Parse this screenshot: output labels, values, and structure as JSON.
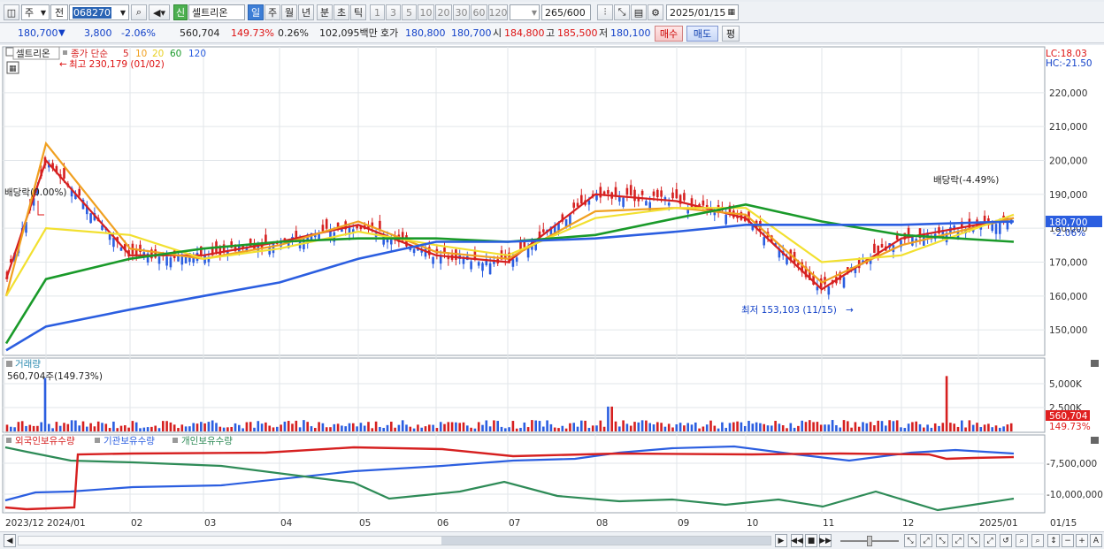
{
  "toolbar": {
    "period_type": "주",
    "market": "전",
    "code": "068270",
    "stock_name": "셀트리온",
    "new_badge": "신",
    "intervals": [
      "일",
      "주",
      "월",
      "년",
      "분",
      "초",
      "틱"
    ],
    "minute_options": [
      "1",
      "3",
      "5",
      "10",
      "20",
      "30",
      "60",
      "120"
    ],
    "count": "265",
    "count_max": "/600",
    "date": "2025/01/15"
  },
  "quote": {
    "price": "180,700",
    "arrow": "▼",
    "change": "3,800",
    "change_pct": "-2.06%",
    "volume": "560,704",
    "volume_ratio": "149.73%",
    "turnover_pct": "0.26%",
    "amount": "102,095백만",
    "ask_label": "호가",
    "bid_price": "180,800",
    "ask_price": "180,700",
    "open_label": "시",
    "open": "184,800",
    "high_label": "고",
    "high": "185,500",
    "low_label": "저",
    "low": "180,100",
    "buy_button": "매수",
    "sell_button": "매도",
    "eval_button": "평"
  },
  "price_panel": {
    "legend_name": "셀트리온",
    "legend_ma_label": "종가 단순",
    "ma_periods": [
      "5",
      "10",
      "20",
      "60",
      "120"
    ],
    "ma_colors": [
      "#d62020",
      "#f0a020",
      "#f2e030",
      "#1a9a2a",
      "#2b5ee0"
    ],
    "high_note": "최고 230,179 (01/02)",
    "low_note": "최저 153,103 (11/15)",
    "dividend_note_1": "배당락(0.00%)",
    "dividend_note_2": "배당락(-4.49%)",
    "lc": "LC:18.03",
    "hc": "HC:-21.50",
    "current_price_tag": "180,700",
    "current_pct_tag": "-2.06%",
    "y_ticks": [
      "220,000",
      "210,000",
      "200,000",
      "190,000",
      "180,000",
      "170,000",
      "160,000",
      "150,000"
    ]
  },
  "volume_panel": {
    "title": "거래량",
    "value": "560,704주(149.73%)",
    "y_ticks": [
      "5,000K",
      "2,500K"
    ],
    "tag_value": "560,704",
    "tag_pct": "149.73%"
  },
  "holdings_panel": {
    "series": [
      "외국인보유수량",
      "기관보유수량",
      "개인보유수량"
    ],
    "colors": [
      "#d62020",
      "#2b5ee0",
      "#2e8b57"
    ],
    "y_ticks": [
      "-7,500,000",
      "-10,000,000"
    ]
  },
  "x_axis": [
    "2023/12",
    "2024/01",
    "02",
    "03",
    "04",
    "05",
    "06",
    "07",
    "08",
    "09",
    "10",
    "11",
    "12",
    "2025/01",
    "01/15"
  ],
  "chart_data": {
    "type": "line",
    "title": "셀트리온",
    "x": [
      "2023/12",
      "2024/01",
      "02",
      "03",
      "04",
      "05",
      "06",
      "07",
      "08",
      "09",
      "10",
      "11",
      "12",
      "2025/01"
    ],
    "ylim": [
      143000,
      233000
    ],
    "series": [
      {
        "name": "5",
        "values": [
          165000,
          200000,
          172000,
          172000,
          176000,
          181000,
          172000,
          170000,
          190000,
          188000,
          183000,
          162000,
          177000,
          183000
        ]
      },
      {
        "name": "10",
        "values": [
          160000,
          205000,
          174000,
          171000,
          175000,
          182000,
          173000,
          171000,
          185000,
          186000,
          184000,
          164000,
          175000,
          183000
        ]
      },
      {
        "name": "20",
        "values": [
          160000,
          180000,
          178000,
          171000,
          174000,
          179000,
          175000,
          172000,
          183000,
          186000,
          186000,
          170000,
          172000,
          184000
        ]
      },
      {
        "name": "60",
        "values": [
          146000,
          165000,
          171000,
          174000,
          176000,
          177000,
          177000,
          176000,
          178000,
          183000,
          187000,
          182000,
          178000,
          176000
        ]
      },
      {
        "name": "120",
        "values": [
          144000,
          151000,
          156000,
          160000,
          164000,
          171000,
          176000,
          176000,
          177000,
          179000,
          181000,
          181000,
          181000,
          182000
        ]
      }
    ]
  }
}
